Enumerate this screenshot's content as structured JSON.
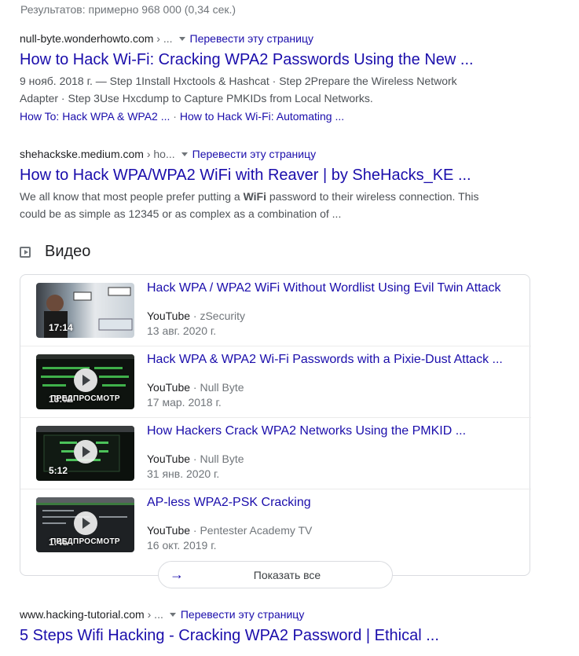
{
  "stats": "Результатов: примерно 968 000 (0,34 сек.)",
  "results": [
    {
      "domain": "null-byte.wonderhowto.com",
      "path": " › ...",
      "translate": "Перевести эту страницу",
      "title": "How to Hack Wi-Fi: Cracking WPA2 Passwords Using the New ...",
      "snippet1": "9 нояб. 2018 г. — Step 1Install Hxctools & Hashcat · Step 2Prepare the Wireless Network",
      "snippet2": "Adapter · Step 3Use Hxcdump to Capture PMKIDs from Local Networks.",
      "sitelink1": "How To: Hack WPA & WPA2 ...",
      "sitelink_sep": " · ",
      "sitelink2": "How to Hack Wi-Fi: Automating ..."
    },
    {
      "domain": "shehackske.medium.com",
      "path": " › ho...",
      "translate": "Перевести эту страницу",
      "title": "How to Hack WPA/WPA2 WiFi with Reaver | by SheHacks_KE ...",
      "snippet1_a": "We all know that most people prefer putting a ",
      "snippet1_bold": "WiFi",
      "snippet1_b": " password to their wireless connection. This",
      "snippet2": "could be as simple as 12345 or as complex as a combination of ..."
    },
    {
      "domain": "www.hacking-tutorial.com",
      "path": " › ...",
      "translate": "Перевести эту страницу",
      "title": "5 Steps Wifi Hacking - Cracking WPA2 Password | Ethical ..."
    }
  ],
  "videos_section": {
    "heading": "Видео",
    "items": [
      {
        "title": "Hack WPA / WPA2 WiFi Without Wordlist Using Evil Twin Attack",
        "source": "YouTube",
        "channel": "zSecurity",
        "date": "13 авг. 2020 г.",
        "duration": "17:14",
        "preview": ""
      },
      {
        "title": "Hack WPA & WPA2 Wi-Fi Passwords with a Pixie-Dust Attack ...",
        "source": "YouTube",
        "channel": "Null Byte",
        "date": "17 мар. 2018 г.",
        "duration": "13:02",
        "preview": "ПРЕДПРОСМОТР"
      },
      {
        "title": "How Hackers Crack WPA2 Networks Using the PMKID ...",
        "source": "YouTube",
        "channel": "Null Byte",
        "date": "31 янв. 2020 г.",
        "duration": "5:12",
        "preview": ""
      },
      {
        "title": "AP-less WPA2-PSK Cracking",
        "source": "YouTube",
        "channel": "Pentester Academy TV",
        "date": "16 окт. 2019 г.",
        "duration": "1:45",
        "preview": "ПРЕДПРОСМОТР"
      }
    ],
    "separator": " · ",
    "show_all": "Показать все",
    "show_all_icon": "arrow-right-icon"
  },
  "colors": {
    "link": "#1a0dab",
    "text": "#202124",
    "muted": "#70757a",
    "border": "#dadce0"
  }
}
